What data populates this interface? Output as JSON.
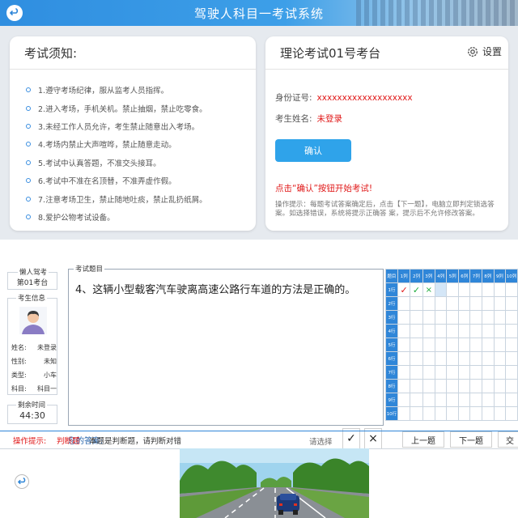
{
  "top": {
    "title": "驾驶人科目一考试系统",
    "notice_title": "考试须知:",
    "rules": [
      "1.遵守考场纪律，服从监考人员指挥。",
      "2.进入考场，手机关机。禁止抽烟，禁止吃零食。",
      "3.未经工作人员允许，考生禁止随意出入考场。",
      "4.考场内禁止大声喧哗，禁止随意走动。",
      "5.考试中认真答题，不准交头接耳。",
      "6.考试中不准在名顶替，不准弄虚作假。",
      "7.注意考场卫生，禁止随地吐痰，禁止乱扔纸屑。",
      "8.爱护公物考试设备。"
    ],
    "station_title": "理论考试01号考台",
    "settings_label": "设置",
    "id_label": "身份证号:",
    "id_value": "xxxxxxxxxxxxxxxxxxx",
    "name_label": "考生姓名:",
    "name_value": "未登录",
    "confirm_label": "确认",
    "start_note": "点击“确认”按钮开始考试!",
    "op_tip": "操作提示：每题考试答案确定后，点击【下一题】，电脑立即判定锁选答案。如选择错误，系统将提示正确答 案，提示后不允许修改答案。"
  },
  "bottom": {
    "seat_label": "懒人驾考",
    "seat_value": "第01考台",
    "examinee_label": "考生信息",
    "info": [
      {
        "k": "姓名:",
        "v": "未登录"
      },
      {
        "k": "性别:",
        "v": "未知"
      },
      {
        "k": "类型:",
        "v": "小车"
      },
      {
        "k": "科目:",
        "v": "科目一"
      }
    ],
    "time_label": "剩余时间",
    "time_value": "44:30",
    "question_label": "考试题目",
    "question_text": "4、这辆小型载客汽车驶离高速公路行车道的方法是正确的。",
    "answer_label": "您的答案:",
    "answer_hint": "请选择",
    "true_symbol": "✓",
    "false_symbol": "×",
    "grid_corner": "题目",
    "grid_cols": [
      "1列",
      "2列",
      "3列",
      "4列",
      "5列",
      "6列",
      "7列",
      "8列",
      "9列",
      "10列"
    ],
    "grid_rows": [
      "1行",
      "2行",
      "3行",
      "4行",
      "5行",
      "6行",
      "7行",
      "8行",
      "9行",
      "10行"
    ],
    "op_label": "操作提示:",
    "op_type": "判断题",
    "op_msg": "本题是判断题，请判断对错",
    "prev_label": "上一题",
    "next_label": "下一题",
    "submit_label": "交"
  },
  "colors": {
    "accent": "#2f86d8",
    "danger": "#e01818",
    "ok": "#1aaa3a"
  }
}
